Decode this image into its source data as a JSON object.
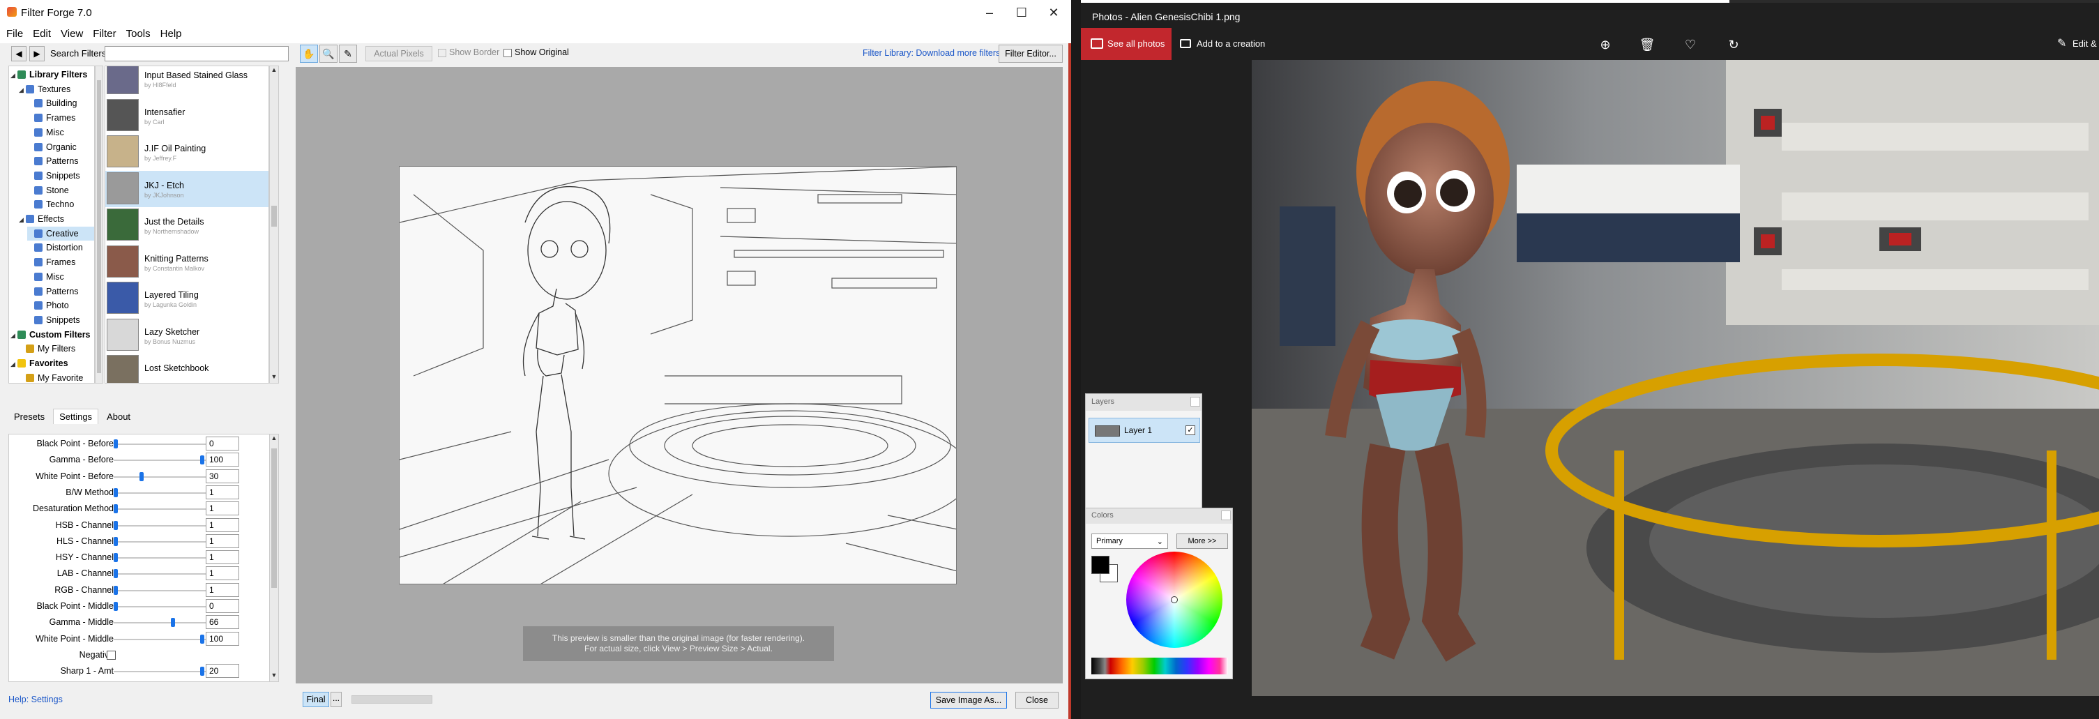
{
  "ff": {
    "title": "Filter Forge 7.0",
    "menu": [
      "File",
      "Edit",
      "View",
      "Filter",
      "Tools",
      "Help"
    ],
    "search_label": "Search Filters:",
    "search_value": "",
    "tree": [
      {
        "label": "Library Filters",
        "depth": 0,
        "bold": true,
        "color": "#2e8b57"
      },
      {
        "label": "Textures",
        "depth": 1,
        "color": "#4a7bd0"
      },
      {
        "label": "Building",
        "depth": 2,
        "color": "#4a7bd0"
      },
      {
        "label": "Frames",
        "depth": 2,
        "color": "#4a7bd0"
      },
      {
        "label": "Misc",
        "depth": 2,
        "color": "#4a7bd0"
      },
      {
        "label": "Organic",
        "depth": 2,
        "color": "#4a7bd0"
      },
      {
        "label": "Patterns",
        "depth": 2,
        "color": "#4a7bd0"
      },
      {
        "label": "Snippets",
        "depth": 2,
        "color": "#4a7bd0"
      },
      {
        "label": "Stone",
        "depth": 2,
        "color": "#4a7bd0"
      },
      {
        "label": "Techno",
        "depth": 2,
        "color": "#4a7bd0"
      },
      {
        "label": "Effects",
        "depth": 1,
        "color": "#4a7bd0"
      },
      {
        "label": "Creative",
        "depth": 2,
        "color": "#4a7bd0",
        "selected": true
      },
      {
        "label": "Distortion",
        "depth": 2,
        "color": "#4a7bd0"
      },
      {
        "label": "Frames",
        "depth": 2,
        "color": "#4a7bd0"
      },
      {
        "label": "Misc",
        "depth": 2,
        "color": "#4a7bd0"
      },
      {
        "label": "Patterns",
        "depth": 2,
        "color": "#4a7bd0"
      },
      {
        "label": "Photo",
        "depth": 2,
        "color": "#4a7bd0"
      },
      {
        "label": "Snippets",
        "depth": 2,
        "color": "#4a7bd0"
      },
      {
        "label": "Custom Filters",
        "depth": 0,
        "bold": true,
        "color": "#2e8b57"
      },
      {
        "label": "My Filters",
        "depth": 1,
        "color": "#d4a017"
      },
      {
        "label": "Favorites",
        "depth": 0,
        "bold": true,
        "color": "#f1c40f"
      },
      {
        "label": "My Favorite",
        "depth": 1,
        "color": "#d4a017"
      }
    ],
    "filters": [
      {
        "name": "Input Based Stained Glass",
        "author": "by Hl8Ffeld",
        "color": "#6a6a8a"
      },
      {
        "name": "Intensafier",
        "author": "by Carl",
        "color": "#555555"
      },
      {
        "name": "J.IF Oil Painting",
        "author": "by Jeffrey.F",
        "color": "#c7b28a"
      },
      {
        "name": "JKJ - Etch",
        "author": "by JKJohnson",
        "color": "#9a9a9a",
        "selected": true
      },
      {
        "name": "Just the Details",
        "author": "by Northernshadow",
        "color": "#3a6a3a"
      },
      {
        "name": "Knitting Patterns",
        "author": "by Constantin Malkov",
        "color": "#8a5a4a"
      },
      {
        "name": "Layered Tiling",
        "author": "by Lagunka Goldin",
        "color": "#3a5aa8"
      },
      {
        "name": "Lazy Sketcher",
        "author": "by Bonus Nuzmus",
        "color": "#d8d8d8"
      },
      {
        "name": "Lost Sketchbook",
        "author": "",
        "color": "#7a7060"
      }
    ],
    "tabs": [
      "Presets",
      "Settings",
      "About"
    ],
    "active_tab": "Settings",
    "settings": [
      {
        "label": "Black Point - Before",
        "value": "0",
        "pos": 0
      },
      {
        "label": "Gamma - Before",
        "value": "100",
        "pos": 1
      },
      {
        "label": "White Point - Before",
        "value": "30",
        "pos": 0.3
      },
      {
        "label": "B/W Method",
        "value": "1",
        "pos": 0
      },
      {
        "label": "Desaturation Method",
        "value": "1",
        "pos": 0
      },
      {
        "label": "HSB - Channel",
        "value": "1",
        "pos": 0
      },
      {
        "label": "HLS - Channel",
        "value": "1",
        "pos": 0
      },
      {
        "label": "HSY - Channel",
        "value": "1",
        "pos": 0
      },
      {
        "label": "LAB - Channel",
        "value": "1",
        "pos": 0
      },
      {
        "label": "RGB - Channel",
        "value": "1",
        "pos": 0
      },
      {
        "label": "Black Point - Middle",
        "value": "0",
        "pos": 0
      },
      {
        "label": "Gamma - Middle",
        "value": "66",
        "pos": 0.66
      },
      {
        "label": "White Point - Middle",
        "value": "100",
        "pos": 1
      },
      {
        "label": "Negative",
        "value": "",
        "checkbox": true
      },
      {
        "label": "Sharp 1 - Amt",
        "value": "20",
        "pos": 1
      }
    ],
    "help_text": "Help: Settings",
    "toolbar": {
      "actual_pixels": "Actual Pixels",
      "show_border": "Show Border",
      "show_original": "Show Original",
      "download_link": "Filter Library: Download more filters",
      "filter_editor": "Filter Editor..."
    },
    "notice_line1": "This preview is smaller than the original image (for faster rendering).",
    "notice_line2": "For actual size, click View > Preview Size > Actual.",
    "final_label": "Final",
    "more_label": "...",
    "save_label": "Save Image As...",
    "close_label": "Close"
  },
  "photos": {
    "title": "Photos - Alien GenesisChibi 1.png",
    "see_all": "See all photos",
    "add_creation": "Add to a creation",
    "edit_label": "Edit &",
    "layers_title": "Layers",
    "layer_name": "Layer 1",
    "colors_title": "Colors",
    "colors_mode": "Primary",
    "colors_more": "More >>"
  },
  "colors": {
    "accent_red": "#c2272d",
    "selection_blue": "#cce4f7",
    "link_blue": "#1a56c8"
  }
}
